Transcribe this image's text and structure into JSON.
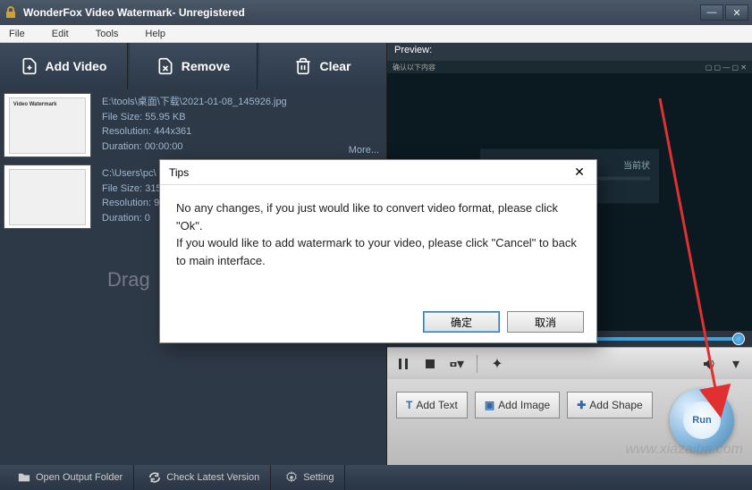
{
  "titlebar": {
    "title": "WonderFox Video Watermark- Unregistered"
  },
  "menubar": {
    "file": "File",
    "edit": "Edit",
    "tools": "Tools",
    "help": "Help"
  },
  "bigbtns": {
    "add": "Add Video",
    "remove": "Remove",
    "clear": "Clear"
  },
  "files": [
    {
      "path": "E:\\tools\\桌面\\下载\\2021-01-08_145926.jpg",
      "size": "File Size: 55.95 KB",
      "res": "Resolution: 444x361",
      "dur": "Duration: 00:00:00",
      "more": "More..."
    },
    {
      "path": "C:\\Users\\pc\\",
      "size": "File Size: 315",
      "res": "Resolution: 9",
      "dur": "Duration: 0"
    }
  ],
  "dragtext": "Drag",
  "preview": {
    "label": "Preview:",
    "toolbar_left": "确认以下内容",
    "right_icons": "▢ ▢ — ▢ ✕",
    "overlay_hint": "当前状"
  },
  "actions": {
    "addText": "Add Text",
    "addImage": "Add Image",
    "addShape": "Add Shape",
    "run": "Run"
  },
  "status": {
    "open": "Open Output Folder",
    "check": "Check Latest Version",
    "setting": "Setting"
  },
  "dialog": {
    "title": "Tips",
    "body1": "No any changes, if you just would like to convert video format, please click \"Ok\".",
    "body2": "If you would like to add watermark to your video, please click \"Cancel\" to back to main interface.",
    "ok": "确定",
    "cancel": "取消"
  },
  "watermark_site": "www.xiazaiba.com"
}
